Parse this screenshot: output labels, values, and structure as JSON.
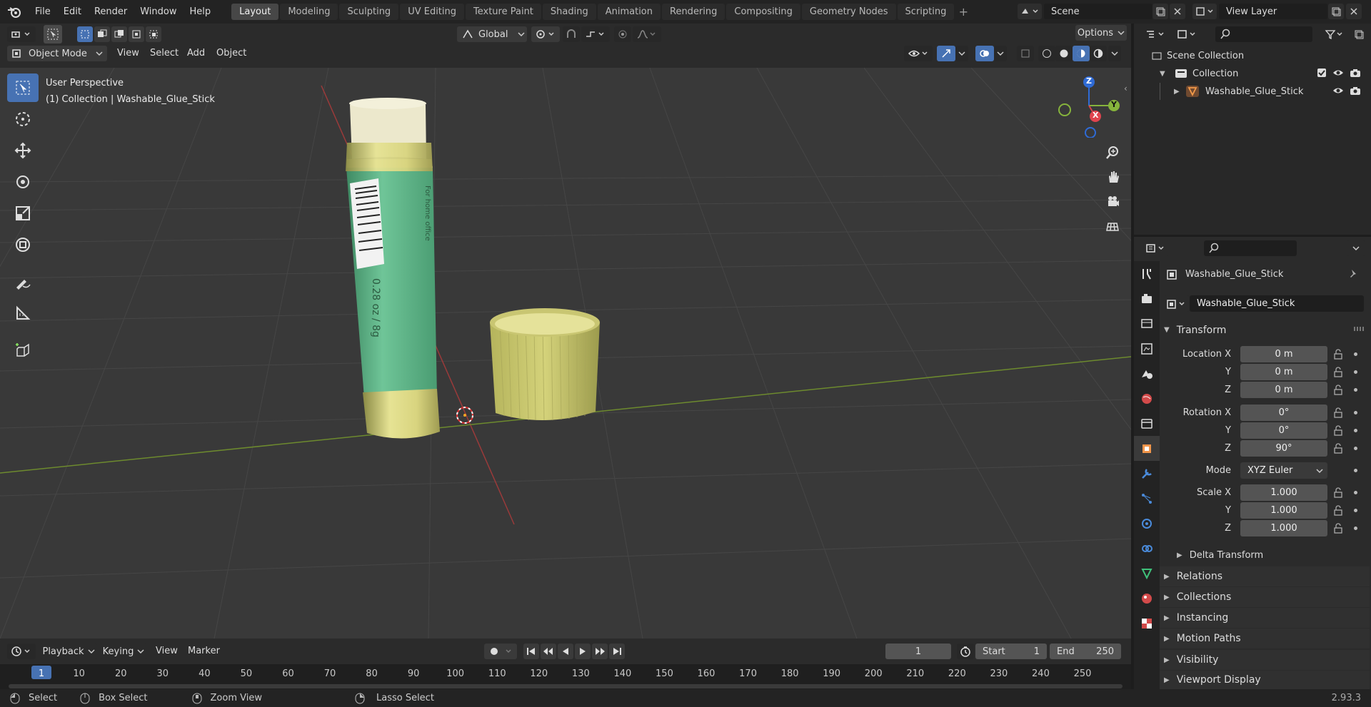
{
  "menu": [
    "File",
    "Edit",
    "Render",
    "Window",
    "Help"
  ],
  "workspaces": [
    "Layout",
    "Modeling",
    "Sculpting",
    "UV Editing",
    "Texture Paint",
    "Shading",
    "Animation",
    "Rendering",
    "Compositing",
    "Geometry Nodes",
    "Scripting"
  ],
  "active_workspace": "Layout",
  "scene": "Scene",
  "view_layer": "View Layer",
  "header": {
    "transform_orientation": "Global",
    "options": "Options",
    "mode": "Object Mode",
    "menus": [
      "View",
      "Select",
      "Add",
      "Object"
    ]
  },
  "viewport": {
    "perspective": "User Perspective",
    "collection_info": "(1) Collection | Washable_Glue_Stick",
    "stick_text1": "0.28 oz / 8g",
    "stick_text2": "For home office"
  },
  "gizmo": {
    "z": "Z",
    "y": "Y",
    "x": "X"
  },
  "outliner": {
    "root": "Scene Collection",
    "collection": "Collection",
    "object": "Washable_Glue_Stick"
  },
  "properties": {
    "object_name": "Washable_Glue_Stick",
    "data_name": "Washable_Glue_Stick",
    "transform": "Transform",
    "location_label": "Location X",
    "rotation_label": "Rotation X",
    "scale_label": "Scale X",
    "y": "Y",
    "z": "Z",
    "location": [
      "0 m",
      "0 m",
      "0 m"
    ],
    "rotation": [
      "0°",
      "0°",
      "90°"
    ],
    "mode_label": "Mode",
    "mode": "XYZ Euler",
    "scale": [
      "1.000",
      "1.000",
      "1.000"
    ],
    "delta": "Delta Transform",
    "panels": [
      "Relations",
      "Collections",
      "Instancing",
      "Motion Paths",
      "Visibility",
      "Viewport Display"
    ]
  },
  "timeline": {
    "menus": [
      "Playback",
      "Keying",
      "View",
      "Marker"
    ],
    "current_frame": "1",
    "start_label": "Start",
    "start": "1",
    "end_label": "End",
    "end": "250",
    "ticks": [
      "1",
      "10",
      "20",
      "30",
      "40",
      "50",
      "60",
      "70",
      "80",
      "90",
      "100",
      "110",
      "120",
      "130",
      "140",
      "150",
      "160",
      "170",
      "180",
      "190",
      "200",
      "210",
      "220",
      "230",
      "240",
      "250"
    ]
  },
  "status": {
    "select": "Select",
    "box_select": "Box Select",
    "zoom": "Zoom View",
    "lasso": "Lasso Select",
    "version": "2.93.3"
  }
}
